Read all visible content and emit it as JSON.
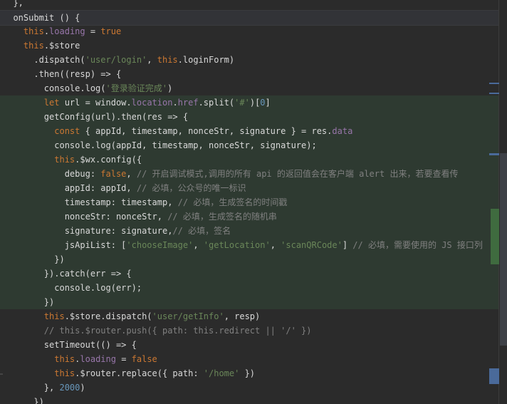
{
  "editor": {
    "current_line_index": 1,
    "green_line_start": 7,
    "green_line_end": 21,
    "lines": [
      "  },",
      "  onSubmit () {",
      "    this.loading = true",
      "    this.$store",
      "      .dispatch('user/login', this.loginForm)",
      "      .then((resp) => {",
      "        console.log('登录验证完成')",
      "        let url = window.location.href.split('#')[0]",
      "        getConfig(url).then(res => {",
      "          const { appId, timestamp, nonceStr, signature } = res.data",
      "          console.log(appId, timestamp, nonceStr, signature);",
      "          this.$wx.config({",
      "            debug: false, // 开启调试模式,调用的所有 api 的返回值会在客户端 alert 出来，若要查看传",
      "            appId: appId, // 必填，公众号的唯一标识",
      "            timestamp: timestamp, // 必填，生成签名的时间戳",
      "            nonceStr: nonceStr, // 必填，生成签名的随机串",
      "            signature: signature,// 必填，签名",
      "            jsApiList: ['chooseImage', 'getLocation', 'scanQRCode'] // 必填，需要使用的 JS 接口列",
      "          })",
      "        }).catch(err => {",
      "          console.log(err);",
      "        })",
      "        this.$store.dispatch('user/getInfo', resp)",
      "        // this.$router.push({ path: this.redirect || '/' })",
      "        setTimeout(() => {",
      "          this.loading = false",
      "          this.$router.replace({ path: '/home' })",
      "        }, 2000)",
      "      })"
    ]
  },
  "colors": {
    "background": "#2b2b2b",
    "current_line": "#323337",
    "changed_block": "#2e3a31",
    "keyword": "#cc7832",
    "text": "#d9d9d9",
    "string": "#6a8759",
    "comment": "#808080",
    "property": "#9876aa",
    "function": "#ffc66d",
    "number": "#6897bb",
    "scroll_green": "#3f6b3f",
    "scroll_blue": "#4a6a9a"
  }
}
